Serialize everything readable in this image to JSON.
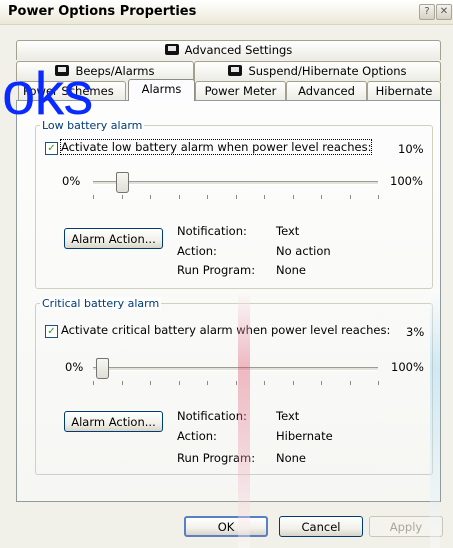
{
  "window": {
    "title": "Power Options Properties",
    "help_glyph": "?",
    "close_glyph": "✕"
  },
  "overlay_text": "oks",
  "tabs": {
    "row1": [
      {
        "label": "Advanced Settings",
        "icon": "battery-icon"
      }
    ],
    "row2": [
      {
        "label": "Beeps/Alarms",
        "icon": "battery-icon"
      },
      {
        "label": "Suspend/Hibernate Options",
        "icon": "battery-icon"
      }
    ],
    "row3": [
      {
        "label": "Power Schemes"
      },
      {
        "label": "Alarms",
        "active": true
      },
      {
        "label": "Power Meter"
      },
      {
        "label": "Advanced"
      },
      {
        "label": "Hibernate"
      }
    ]
  },
  "low_alarm": {
    "group_title": "Low battery alarm",
    "checkbox_label": "Activate low battery alarm when power level reaches:",
    "checked": true,
    "percent_text": "10%",
    "slider_min": "0%",
    "slider_max": "100%",
    "slider_level_pct": 10,
    "button_label": "Alarm Action...",
    "details": [
      {
        "key": "Notification:",
        "value": "Text"
      },
      {
        "key": "Action:",
        "value": "No action"
      },
      {
        "key": "Run Program:",
        "value": "None"
      }
    ]
  },
  "critical_alarm": {
    "group_title": "Critical battery alarm",
    "checkbox_label": "Activate critical battery alarm when power level reaches:",
    "checked": true,
    "percent_text": "3%",
    "slider_min": "0%",
    "slider_max": "100%",
    "slider_level_pct": 3,
    "button_label": "Alarm Action...",
    "details": [
      {
        "key": "Notification:",
        "value": "Text"
      },
      {
        "key": "Action:",
        "value": "Hibernate"
      },
      {
        "key": "Run Program:",
        "value": "None"
      }
    ]
  },
  "footer": {
    "ok_label": "OK",
    "cancel_label": "Cancel",
    "apply_label": "Apply"
  }
}
